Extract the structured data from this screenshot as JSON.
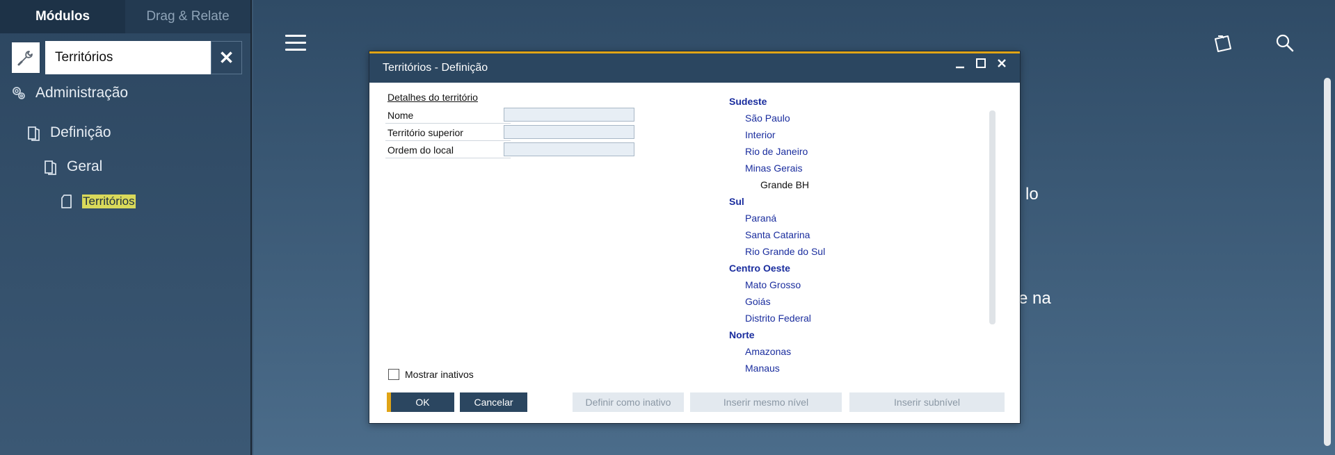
{
  "left_panel": {
    "tabs": [
      "Módulos",
      "Drag & Relate"
    ],
    "search_value": "Territórios",
    "tree": {
      "administracao": "Administração",
      "definicao": "Definição",
      "geral": "Geral",
      "territorios": "Territórios"
    }
  },
  "main": {
    "bg_text_1": "lo",
    "bg_text_2": "e na"
  },
  "dialog": {
    "title": "Territórios - Definição",
    "details_heading": "Detalhes do território",
    "fields": {
      "nome": "Nome",
      "superior": "Território superior",
      "ordem": "Ordem do local"
    },
    "tree": [
      {
        "label": "Sudeste",
        "level": 0
      },
      {
        "label": "São Paulo",
        "level": 1
      },
      {
        "label": "Interior",
        "level": 1
      },
      {
        "label": "Rio de Janeiro",
        "level": 1
      },
      {
        "label": "Minas Gerais",
        "level": 1
      },
      {
        "label": "Grande BH",
        "level": 2
      },
      {
        "label": "Sul",
        "level": 0
      },
      {
        "label": "Paraná",
        "level": 1
      },
      {
        "label": "Santa Catarina",
        "level": 1
      },
      {
        "label": "Rio Grande do Sul",
        "level": 1
      },
      {
        "label": "Centro Oeste",
        "level": 0
      },
      {
        "label": "Mato Grosso",
        "level": 1
      },
      {
        "label": "Goiás",
        "level": 1
      },
      {
        "label": "Distrito Federal",
        "level": 1
      },
      {
        "label": "Norte",
        "level": 0
      },
      {
        "label": "Amazonas",
        "level": 1
      },
      {
        "label": "Manaus",
        "level": 1
      }
    ],
    "mostrar_inativos": "Mostrar inativos",
    "buttons": {
      "ok": "OK",
      "cancel": "Cancelar",
      "inativo": "Definir como inativo",
      "mesmo": "Inserir mesmo nível",
      "sub": "Inserir subnível"
    }
  }
}
